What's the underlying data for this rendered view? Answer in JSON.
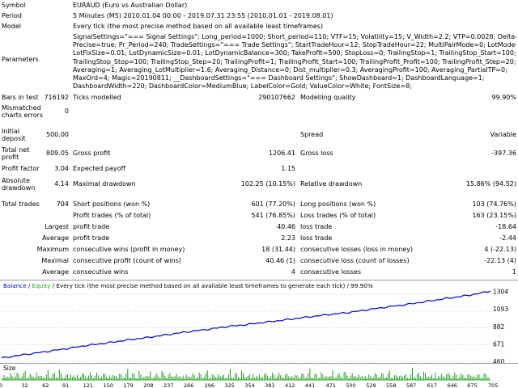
{
  "header": {
    "symbol_label": "Symbol",
    "symbol_value": "EURAUD (Euro vs Australian Dollar)",
    "period_label": "Period",
    "period_value": "5 Minutes (M5) 2010.01.04 00:00 - 2019.07.31 23:55 (2010.01.01 - 2019.08.01)",
    "model_label": "Model",
    "model_value": "Every tick (the most precise method based on all available least timeframes)",
    "parameters_label": "Parameters",
    "parameters_lines": [
      "SignalSettings=\"=== Signal Settings\"; Long_period=1000; Short_period=110; VTF=15; Volatility=15; V_Width=2.2; VTP=0.0028; Delta=0.4;",
      "Precise=true; Pr_Period=240; TradeSettings=\"=== Trade Settings\"; StartTradeHour=12; StopTradeHour=22; MultiPairMode=0; LotMode=0;",
      "LotFixSize=0.01; LotDynamicSize=0.01; LotDynamicBalance=300; TakeProfit=500; StopLoss=0; TrailingStop=1; TrailingStop_Start=100;",
      "TrailingStop_Stop=100; TrailingStop_Step=20; TrailingProfit=1; TrailingProfit_Start=100; TrailingProfit_Profit=100; TrailingProfit_Step=20;",
      "Averaging=1; Averaging_LotMultiplier=1.6; Averaging_Distance=0; Dist_multiplier=0.3; AveragingProfit=100; Averaging_PartialTP=0;",
      "MaxOrd=4; Magic=20190811; __DashboardSettings=\"=== Dashboard Settings\"; ShowDashboard=1; DashboardLanguage=1;",
      "DashboardWidth=220; DashboardColor=MediumBlue; LabelColor=Gold; ValueColor=White; FontSize=8;"
    ]
  },
  "stats": {
    "bars_label": "Bars in test",
    "bars_value": "716192",
    "ticks_label": "Ticks modelled",
    "ticks_value": "290107662",
    "quality_label": "Modelling quality",
    "quality_value": "99.90%",
    "mismatch_label": "Mismatched charts errors",
    "mismatch_value": "0",
    "deposit_label": "Initial deposit",
    "deposit_value": "500.00",
    "spread_label": "Spread",
    "spread_value": "Variable",
    "netprofit_label": "Total net profit",
    "netprofit_value": "809.05",
    "grossprofit_label": "Gross profit",
    "grossprofit_value": "1206.41",
    "grossloss_label": "Gross loss",
    "grossloss_value": "-397.36",
    "pf_label": "Profit factor",
    "pf_value": "3.04",
    "payoff_label": "Expected payoff",
    "payoff_value": "1.15",
    "absdd_label": "Absolute drawdown",
    "absdd_value": "4.14",
    "maxdd_label": "Maximal drawdown",
    "maxdd_value": "102.25 (10.15%)",
    "reldd_label": "Relative drawdown",
    "reldd_value": "15.86% (94.52)",
    "trades_label": "Total trades",
    "trades_value": "704",
    "short_label": "Short positions (won %)",
    "short_value": "601 (77.20%)",
    "long_label": "Long positions (won %)",
    "long_value": "103 (74.76%)",
    "profittrades_label": "Profit trades (% of total)",
    "profittrades_value": "541 (76.85%)",
    "losstrades_label": "Loss trades (% of total)",
    "losstrades_value": "163 (23.15%)",
    "largest_label": "Largest",
    "largest_profit_label": "profit trade",
    "largest_profit_value": "40.46",
    "largest_loss_label": "loss trade",
    "largest_loss_value": "-18.64",
    "average_label": "Average",
    "average_profit_label": "profit trade",
    "average_profit_value": "2.23",
    "average_loss_label": "loss trade",
    "average_loss_value": "-2.44",
    "maximum_label": "Maximum",
    "max_wins_label": "consecutive wins (profit in money)",
    "max_wins_value": "18 (31.44)",
    "max_losses_label": "consecutive losses (loss in money)",
    "max_losses_value": "4 (-22.13)",
    "maximal_label": "Maximal",
    "maximal_profit_label": "consecutive profit (count of wins)",
    "maximal_profit_value": "40.46 (1)",
    "maximal_loss_label": "consecutive loss (count of losses)",
    "maximal_loss_value": "-22.13 (4)",
    "avg2_label": "Average",
    "avg_wins_label": "consecutive wins",
    "avg_wins_value": "4",
    "avg_losses_label": "consecutive losses",
    "avg_losses_value": "1"
  },
  "chart_data": {
    "type": "line",
    "title_balance": "Balance",
    "title_sep": " / ",
    "title_equity": "Equity",
    "title_rest": " / Every tick (the most precise method based on all available least timeframes to generate each tick) / 99.90%",
    "y_ticks": [
      "1304",
      "1093",
      "882",
      "671",
      "460"
    ],
    "ylim": [
      460,
      1320
    ],
    "x_ticks": [
      "0",
      "32",
      "62",
      "91",
      "121",
      "150",
      "179",
      "208",
      "237",
      "266",
      "296",
      "325",
      "354",
      "383",
      "412",
      "441",
      "471",
      "500",
      "529",
      "558",
      "587",
      "617",
      "646",
      "675",
      "705"
    ],
    "xlim": [
      0,
      705
    ],
    "series": [
      {
        "name": "Balance",
        "x": [
          0,
          32,
          62,
          91,
          121,
          150,
          179,
          208,
          237,
          266,
          296,
          325,
          354,
          383,
          412,
          441,
          471,
          500,
          529,
          558,
          587,
          617,
          646,
          675,
          705
        ],
        "values": [
          500,
          540,
          575,
          610,
          650,
          680,
          715,
          745,
          780,
          815,
          845,
          880,
          905,
          935,
          965,
          995,
          1025,
          1050,
          1085,
          1120,
          1150,
          1190,
          1225,
          1260,
          1309
        ]
      }
    ],
    "colors": {
      "balance": "#0000cc",
      "equity": "#22a022"
    },
    "size_label": "Size"
  }
}
